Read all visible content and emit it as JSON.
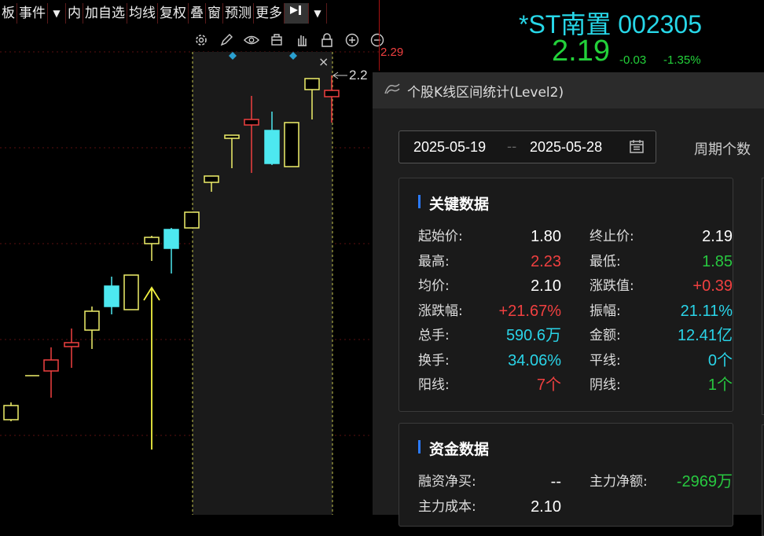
{
  "toolbar": {
    "items": [
      "板",
      "事件",
      "▼",
      "内",
      "加自选",
      "均线",
      "复权",
      "叠",
      "窗",
      "预测",
      "更多",
      "▼"
    ]
  },
  "chart": {
    "price_high": "2.29",
    "price_marker": "2.2",
    "close_icon": "×"
  },
  "quote": {
    "name": "*ST南置 002305",
    "price": "2.19",
    "change": "-0.03",
    "change_pct": "-1.35%"
  },
  "panel": {
    "title": "个股K线区间统计(Level2)",
    "start_date": "2025-05-19",
    "date_sep": "--",
    "end_date": "2025-05-28",
    "period_label": "周期个数",
    "key_data": {
      "title": "关键数据",
      "rows": [
        {
          "l1": "起始价:",
          "v1": "1.80",
          "c1": "white",
          "l2": "终止价:",
          "v2": "2.19",
          "c2": "white"
        },
        {
          "l1": "最高:",
          "v1": "2.23",
          "c1": "red",
          "l2": "最低:",
          "v2": "1.85",
          "c2": "green"
        },
        {
          "l1": "均价:",
          "v1": "2.10",
          "c1": "white",
          "l2": "涨跌值:",
          "v2": "+0.39",
          "c2": "red"
        },
        {
          "l1": "涨跌幅:",
          "v1": "+21.67%",
          "c1": "red",
          "l2": "振幅:",
          "v2": "21.11%",
          "c2": "cyan"
        },
        {
          "l1": "总手:",
          "v1": "590.6万",
          "c1": "cyan",
          "l2": "金额:",
          "v2": "12.41亿",
          "c2": "cyan"
        },
        {
          "l1": "换手:",
          "v1": "34.06%",
          "c1": "cyan",
          "l2": "平线:",
          "v2": "0个",
          "c2": "cyan"
        },
        {
          "l1": "阳线:",
          "v1": "7个",
          "c1": "red",
          "l2": "阴线:",
          "v2": "1个",
          "c2": "green"
        }
      ]
    },
    "fund_data": {
      "title": "资金数据",
      "rows": [
        {
          "l1": "融资净买:",
          "v1": "--",
          "c1": "white",
          "l2": "主力净额:",
          "v2": "-2969万",
          "c2": "green"
        },
        {
          "l1": "主力成本:",
          "v1": "2.10",
          "c1": "white",
          "l2": "",
          "v2": "",
          "c2": "white"
        }
      ]
    }
  },
  "colors": {
    "up": "#f04040",
    "down": "#2ad4e8",
    "yang": "#f0f06a",
    "accent": "#2b7bff"
  }
}
